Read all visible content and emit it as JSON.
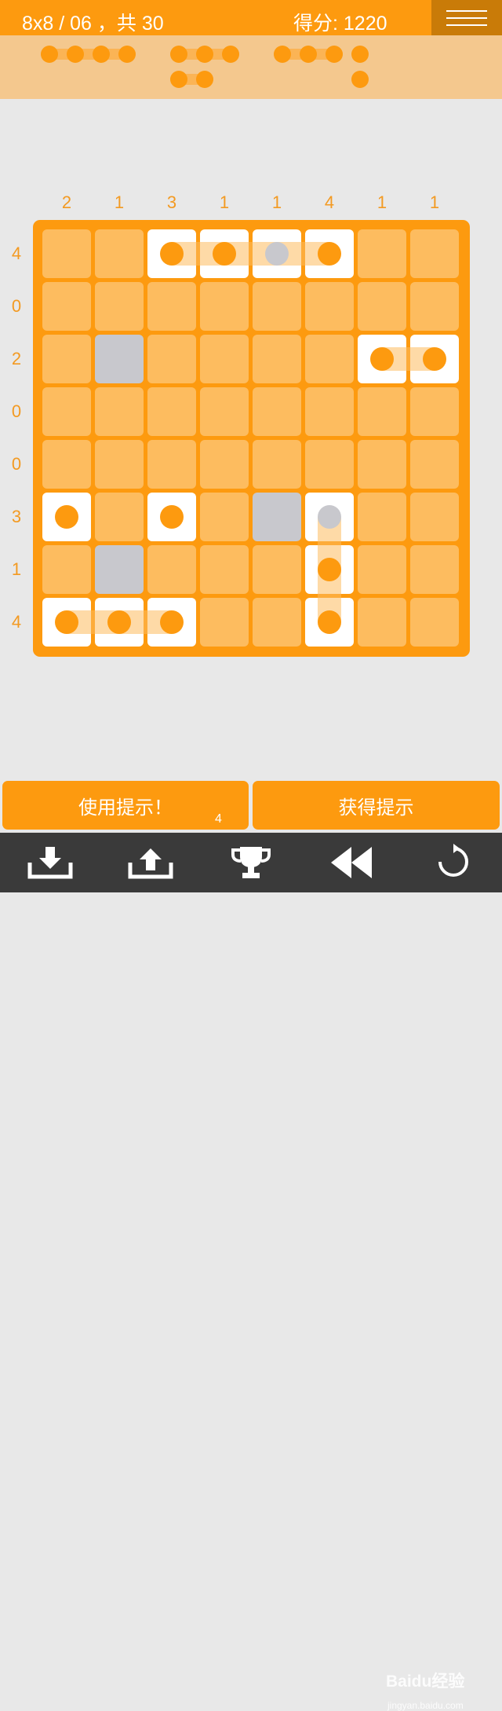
{
  "header": {
    "level_text": "8x8 / 06 ，共 30",
    "score_text": "得分: 1220"
  },
  "pieces_panel": {
    "pieces": [
      {
        "size": 4
      },
      {
        "size": 3
      },
      {
        "size": 3
      },
      {
        "size": 2
      },
      {
        "size": 1
      },
      {
        "size": 1
      }
    ]
  },
  "board": {
    "rows": 8,
    "cols": 8,
    "col_clues": [
      "2",
      "1",
      "3",
      "1",
      "1",
      "4",
      "1",
      "1"
    ],
    "row_clues": [
      "4",
      "0",
      "2",
      "0",
      "0",
      "3",
      "1",
      "4"
    ],
    "cells": [
      {
        "r": 0,
        "c": 2,
        "state": "ship"
      },
      {
        "r": 0,
        "c": 3,
        "state": "ship"
      },
      {
        "r": 0,
        "c": 4,
        "state": "ship"
      },
      {
        "r": 0,
        "c": 5,
        "state": "ship"
      },
      {
        "r": 2,
        "c": 1,
        "state": "water"
      },
      {
        "r": 2,
        "c": 6,
        "state": "ship"
      },
      {
        "r": 2,
        "c": 7,
        "state": "ship"
      },
      {
        "r": 5,
        "c": 0,
        "state": "ship"
      },
      {
        "r": 5,
        "c": 2,
        "state": "ship"
      },
      {
        "r": 5,
        "c": 4,
        "state": "water"
      },
      {
        "r": 5,
        "c": 5,
        "state": "ship"
      },
      {
        "r": 6,
        "c": 1,
        "state": "water"
      },
      {
        "r": 6,
        "c": 5,
        "state": "ship"
      },
      {
        "r": 7,
        "c": 0,
        "state": "ship"
      },
      {
        "r": 7,
        "c": 1,
        "state": "ship"
      },
      {
        "r": 7,
        "c": 2,
        "state": "ship"
      },
      {
        "r": 7,
        "c": 5,
        "state": "ship"
      }
    ],
    "ships": [
      {
        "r": 0,
        "c": 2,
        "len": 4,
        "dir": "h",
        "gray_at": [
          2
        ]
      },
      {
        "r": 2,
        "c": 6,
        "len": 2,
        "dir": "h",
        "gray_at": []
      },
      {
        "r": 5,
        "c": 0,
        "len": 1,
        "dir": "h",
        "gray_at": []
      },
      {
        "r": 5,
        "c": 2,
        "len": 1,
        "dir": "h",
        "gray_at": []
      },
      {
        "r": 5,
        "c": 5,
        "len": 3,
        "dir": "v",
        "gray_at": [
          0
        ]
      },
      {
        "r": 7,
        "c": 0,
        "len": 3,
        "dir": "h",
        "gray_at": []
      }
    ]
  },
  "buttons": {
    "use_hint": "使用提示！",
    "hint_count": "4",
    "get_hint": "获得提示"
  },
  "toolbar": {
    "icons": [
      "download-icon",
      "upload-icon",
      "trophy-icon",
      "rewind-icon",
      "restart-icon"
    ]
  },
  "watermark": {
    "brand": "Baidu经验",
    "url": "jingyan.baidu.com"
  },
  "colors": {
    "accent": "#fd9a0f",
    "cell_empty": "#fdbc5f",
    "cell_water": "#c8c8cd",
    "panel": "#f4c88e",
    "background": "#e8e8e8",
    "toolbar": "#3a3a3a"
  }
}
